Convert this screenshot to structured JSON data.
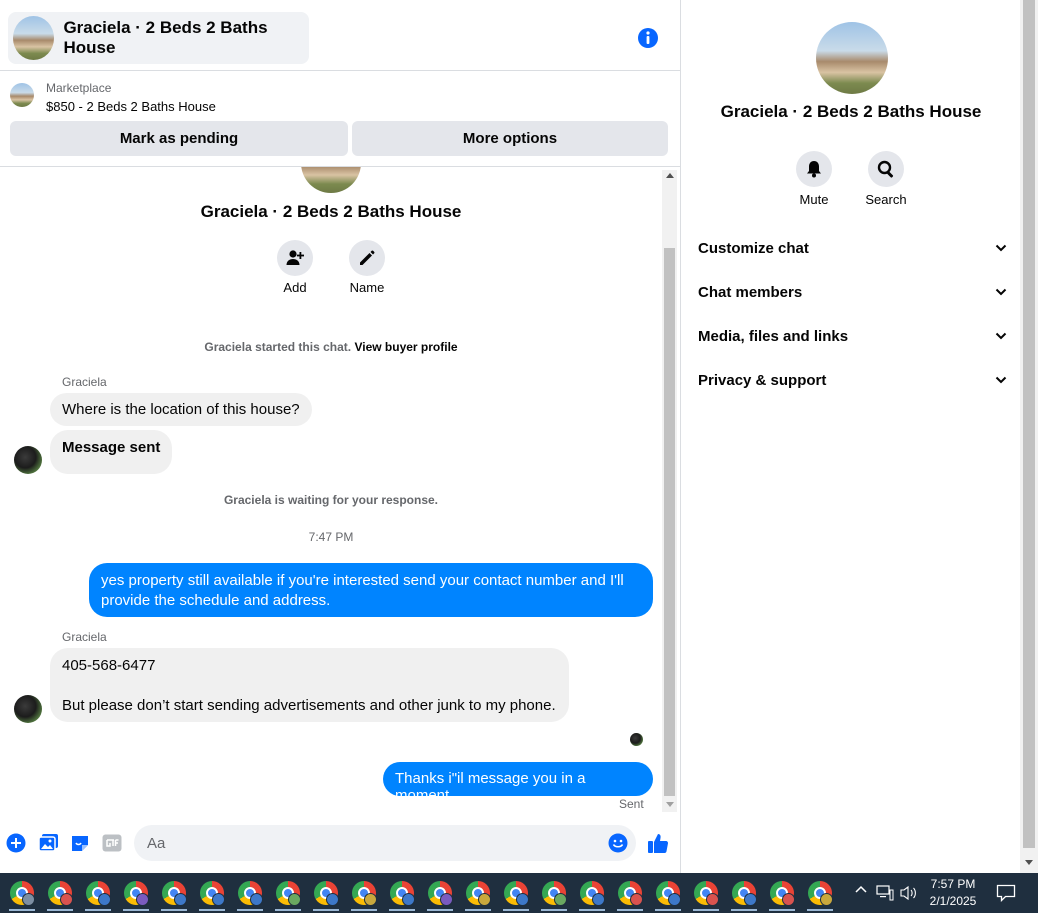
{
  "header": {
    "title": "Graciela · 2 Beds 2 Baths House"
  },
  "listing": {
    "source": "Marketplace",
    "summary": "$850 - 2 Beds 2 Baths House",
    "mark_pending": "Mark as pending",
    "more_options": "More options"
  },
  "chat_intro": {
    "title": "Graciela · 2 Beds 2 Baths House",
    "add_label": "Add",
    "name_label": "Name",
    "started_text": "Graciela started this chat.",
    "view_profile": "View buyer profile"
  },
  "messages": {
    "sender1": "Graciela",
    "msg1": "Where is the location of this house?",
    "msg2": "Message sent",
    "waiting": "Graciela is waiting for your response.",
    "time": "7:47 PM",
    "out1_line1": "yes property still available if you're interested send your contact number and I'll",
    "out1_line2": "provide the schedule and address.",
    "sender2": "Graciela",
    "msg3_line1": "405-568-6477",
    "msg3_line2": "But please don’t start sending advertisements and other junk to my phone.",
    "out2": "Thanks i\"il message you in a moment",
    "status": "Sent"
  },
  "composer": {
    "placeholder": "Aa"
  },
  "info_panel": {
    "title": "Graciela · 2 Beds 2 Baths House",
    "mute": "Mute",
    "search": "Search",
    "sections": [
      "Customize chat",
      "Chat members",
      "Media, files and links",
      "Privacy & support"
    ]
  },
  "taskbar": {
    "time": "7:57 PM",
    "date": "2/1/2025",
    "app_count": 22
  },
  "colors": {
    "accent": "#0084ff",
    "info_icon": "#0866ff",
    "bubble_in": "#f0f0f0",
    "gray_button": "#e4e6eb"
  }
}
